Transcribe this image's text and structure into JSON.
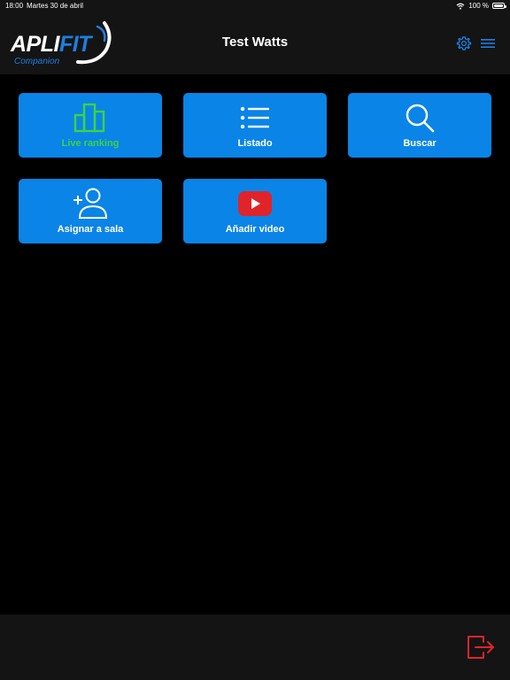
{
  "status_bar": {
    "time": "18:00",
    "date": "Martes 30 de abril",
    "battery": "100 %"
  },
  "header": {
    "logo_main": "APLI",
    "logo_accent": "FIT",
    "logo_sub": "Companion",
    "title": "Test Watts"
  },
  "tiles": [
    {
      "label": "Live ranking",
      "icon": "bar-chart-icon"
    },
    {
      "label": "Listado",
      "icon": "list-icon"
    },
    {
      "label": "Buscar",
      "icon": "search-icon"
    },
    {
      "label": "Asignar a sala",
      "icon": "add-user-icon"
    },
    {
      "label": "Añadir video",
      "icon": "youtube-play-icon"
    }
  ],
  "colors": {
    "tile_blue": "#0a84e6",
    "active_green": "#3bd444",
    "logout_red": "#e0242a",
    "bar_dark": "#141414"
  }
}
